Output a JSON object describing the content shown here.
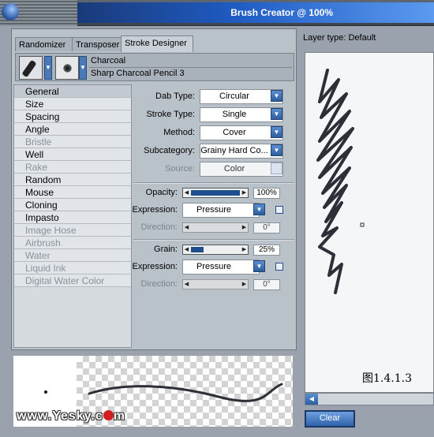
{
  "window": {
    "title": "Brush Creator @ 100%"
  },
  "tabs": [
    {
      "label": "Randomizer"
    },
    {
      "label": "Transposer"
    },
    {
      "label": "Stroke Designer",
      "active": true
    }
  ],
  "variant": {
    "category": "Charcoal",
    "name": "Sharp Charcoal Pencil 3"
  },
  "categories": [
    {
      "label": "General",
      "state": "selected"
    },
    {
      "label": "Size",
      "state": "normal"
    },
    {
      "label": "Spacing",
      "state": "normal"
    },
    {
      "label": "Angle",
      "state": "normal"
    },
    {
      "label": "Bristle",
      "state": "disabled"
    },
    {
      "label": "Well",
      "state": "normal"
    },
    {
      "label": "Rake",
      "state": "disabled"
    },
    {
      "label": "Random",
      "state": "normal"
    },
    {
      "label": "Mouse",
      "state": "normal"
    },
    {
      "label": "Cloning",
      "state": "normal"
    },
    {
      "label": "Impasto",
      "state": "normal"
    },
    {
      "label": "Image Hose",
      "state": "disabled"
    },
    {
      "label": "Airbrush",
      "state": "disabled"
    },
    {
      "label": "Water",
      "state": "disabled"
    },
    {
      "label": "Liquid Ink",
      "state": "disabled"
    },
    {
      "label": "Digital Water Color",
      "state": "disabled"
    }
  ],
  "general": {
    "dab_type": {
      "label": "Dab Type:",
      "value": "Circular"
    },
    "stroke_type": {
      "label": "Stroke Type:",
      "value": "Single"
    },
    "method": {
      "label": "Method:",
      "value": "Cover"
    },
    "subcategory": {
      "label": "Subcategory:",
      "value": "Grainy Hard Co..."
    },
    "source": {
      "label": "Source:",
      "value": "Color"
    },
    "opacity": {
      "label": "Opacity:",
      "value": "100%",
      "level": 1.0
    },
    "opacity_expression": {
      "label": "Expression:",
      "value": "Pressure"
    },
    "opacity_direction": {
      "label": "Direction:",
      "value": "0°"
    },
    "grain": {
      "label": "Grain:",
      "value": "25%",
      "level": 0.25
    },
    "grain_expression": {
      "label": "Expression:",
      "value": "Pressure"
    },
    "grain_direction": {
      "label": "Direction:",
      "value": "0°"
    }
  },
  "preview": {
    "watermark": "www.Yesky.c",
    "watermark_tail": "m"
  },
  "canvas": {
    "layer_type": "Layer type: Default",
    "caption": "图1.4.1.3",
    "clear_label": "Clear"
  },
  "colors": {
    "accent": "#1f5cc4",
    "stroke": "#2b2f36"
  }
}
